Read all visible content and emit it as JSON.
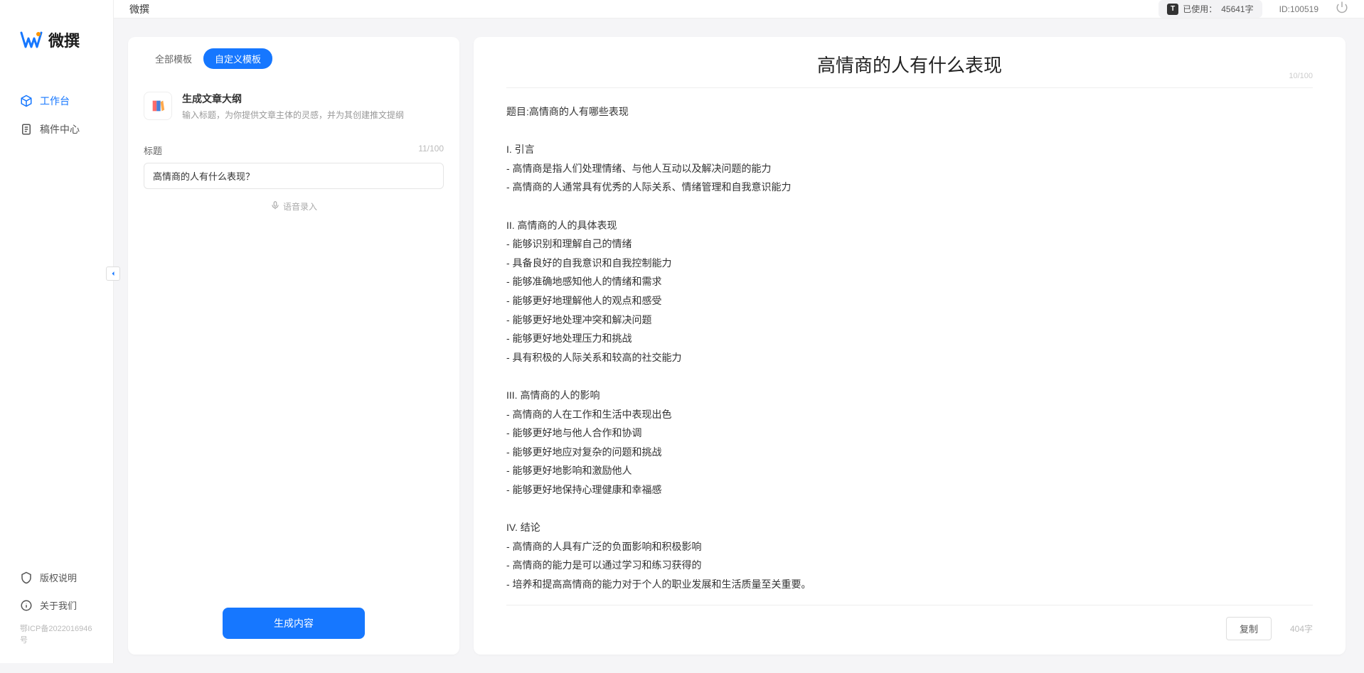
{
  "app": {
    "title": "微撰",
    "logo_text": "微撰"
  },
  "sidebar": {
    "items": [
      {
        "label": "工作台",
        "icon": "cube-icon",
        "active": true
      },
      {
        "label": "稿件中心",
        "icon": "document-icon",
        "active": false
      }
    ],
    "bottom": [
      {
        "label": "版权说明",
        "icon": "shield-icon"
      },
      {
        "label": "关于我们",
        "icon": "info-icon"
      }
    ],
    "icp": "鄂ICP备2022016946号"
  },
  "topbar": {
    "usage_prefix": "已使用：",
    "usage_value": "45641字",
    "user_id": "ID:100519"
  },
  "left_panel": {
    "tabs": [
      {
        "label": "全部模板",
        "active": false
      },
      {
        "label": "自定义模板",
        "active": true
      }
    ],
    "template": {
      "name": "生成文章大纲",
      "desc": "输入标题，为你提供文章主体的灵感，并为其创建推文提纲"
    },
    "form": {
      "field_label": "标题",
      "field_counter": "11/100",
      "input_value": "高情商的人有什么表现？",
      "voice_link": "语音录入",
      "generate_label": "生成内容"
    }
  },
  "right_panel": {
    "title": "高情商的人有什么表现",
    "title_counter": "10/100",
    "content": "题目:高情商的人有哪些表现\n\nI. 引言\n- 高情商是指人们处理情绪、与他人互动以及解决问题的能力\n- 高情商的人通常具有优秀的人际关系、情绪管理和自我意识能力\n\nII. 高情商的人的具体表现\n- 能够识别和理解自己的情绪\n- 具备良好的自我意识和自我控制能力\n- 能够准确地感知他人的情绪和需求\n- 能够更好地理解他人的观点和感受\n- 能够更好地处理冲突和解决问题\n- 能够更好地处理压力和挑战\n- 具有积极的人际关系和较高的社交能力\n\nIII. 高情商的人的影响\n- 高情商的人在工作和生活中表现出色\n- 能够更好地与他人合作和协调\n- 能够更好地应对复杂的问题和挑战\n- 能够更好地影响和激励他人\n- 能够更好地保持心理健康和幸福感\n\nIV. 结论\n- 高情商的人具有广泛的负面影响和积极影响\n- 高情商的能力是可以通过学习和练习获得的\n- 培养和提高高情商的能力对于个人的职业发展和生活质量至关重要。",
    "copy_label": "复制",
    "word_count": "404字"
  }
}
